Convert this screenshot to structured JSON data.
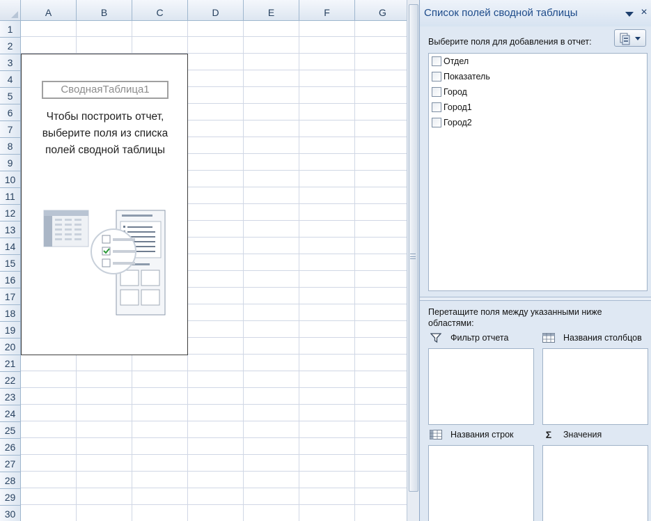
{
  "sheet": {
    "columns": [
      "A",
      "B",
      "C",
      "D",
      "E",
      "F",
      "G"
    ],
    "rows": [
      "1",
      "2",
      "3",
      "4",
      "5",
      "6",
      "7",
      "8",
      "9",
      "10",
      "11",
      "12",
      "13",
      "14",
      "15",
      "16",
      "17",
      "18",
      "19",
      "20",
      "21",
      "22",
      "23",
      "24",
      "25",
      "26",
      "27",
      "28",
      "29",
      "30"
    ]
  },
  "pivot_placeholder": {
    "name": "СводнаяТаблица1",
    "hint_lines": [
      "Чтобы построить отчет,",
      "выберите поля из списка",
      "полей сводной таблицы"
    ]
  },
  "field_list": {
    "title": "Список полей сводной таблицы",
    "choose_label": "Выберите поля для добавления в отчет:",
    "fields": [
      "Отдел",
      "Показатель",
      "Город",
      "Город1",
      "Город2"
    ],
    "drag_label": "Перетащите поля между указанными ниже областями:",
    "zones": {
      "report_filter": "Фильтр отчета",
      "column_labels": "Названия столбцов",
      "row_labels": "Названия строк",
      "values": "Значения"
    },
    "close_glyph": "×",
    "sigma_glyph": "Σ"
  },
  "colors": {
    "pane_background": "#dfe8f3",
    "title_text": "#1d4b8a",
    "header_border": "#9eb6ce",
    "gridline": "#d0d7e5"
  },
  "icons": [
    "corner-select-icon",
    "dropdown-arrow-icon",
    "close-icon",
    "field-layout-icon",
    "filter-icon",
    "column-grid-icon",
    "row-grid-icon",
    "sigma-icon",
    "pivot-illustration-icon"
  ]
}
